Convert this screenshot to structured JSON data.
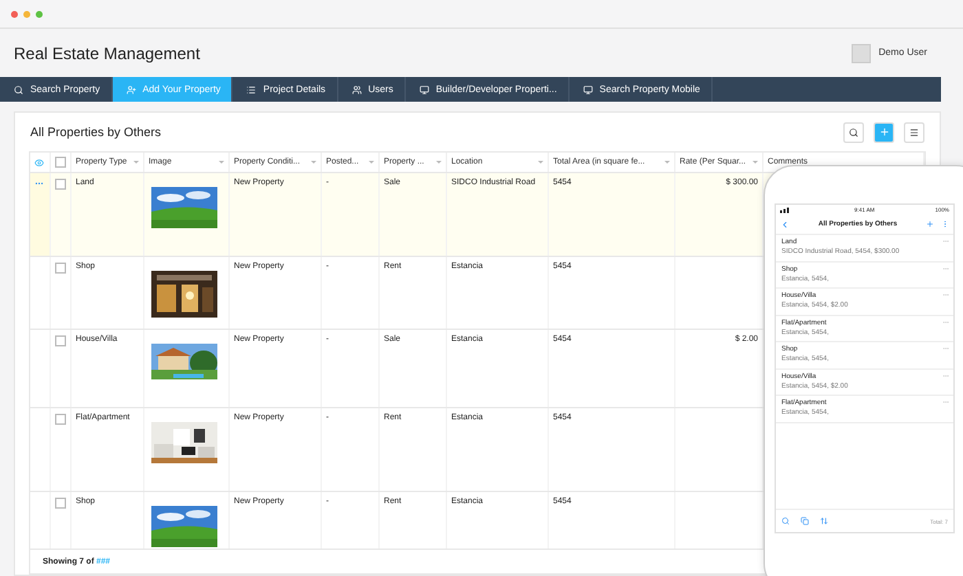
{
  "app": {
    "title": "Real Estate Management",
    "user": "Demo User"
  },
  "nav": [
    {
      "label": "Search Property",
      "selected": false
    },
    {
      "label": "Add Your Property",
      "selected": true
    },
    {
      "label": "Project Details",
      "selected": false
    },
    {
      "label": "Users",
      "selected": false
    },
    {
      "label": "Builder/Developer Properti...",
      "selected": false
    },
    {
      "label": "Search Property Mobile",
      "selected": false
    }
  ],
  "panel": {
    "title": "All Properties by Others",
    "footer_prefix": "Showing 7 of ",
    "footer_link": "###"
  },
  "table": {
    "select_all_checked": false,
    "columns": [
      "Property Type",
      "Image",
      "Property Conditi...",
      "Posted...",
      "Property ...",
      "Location",
      "Total Area (in square fe...",
      "Rate (Per Squar...",
      "Comments"
    ],
    "rows": [
      {
        "selected": true,
        "checked": false,
        "cells": [
          "Land",
          "",
          "New Property",
          "-",
          "Sale",
          "SIDCO Industrial Road",
          "5454",
          "$ 300.00",
          ""
        ]
      },
      {
        "selected": false,
        "checked": false,
        "cells": [
          "Shop",
          "",
          "New Property",
          "-",
          "Rent",
          "Estancia",
          "5454",
          "",
          ""
        ]
      },
      {
        "selected": false,
        "checked": false,
        "cells": [
          "House/Villa",
          "",
          "New Property",
          "-",
          "Sale",
          "Estancia",
          "5454",
          "$ 2.00",
          ""
        ]
      },
      {
        "selected": false,
        "checked": false,
        "cells": [
          "Flat/Apartment",
          "",
          "New Property",
          "-",
          "Rent",
          "Estancia",
          "5454",
          "",
          ""
        ]
      },
      {
        "selected": false,
        "checked": false,
        "cells": [
          "Shop",
          "",
          "New Property",
          "-",
          "Rent",
          "Estancia",
          "5454",
          "",
          ""
        ]
      }
    ]
  },
  "phone": {
    "time": "9:41 AM",
    "battery": "100%",
    "title": "All Properties by Others",
    "total": "Total: 7",
    "items": [
      {
        "title": "Land",
        "subtitle": "SIDCO Industrial Road, 5454, $300.00"
      },
      {
        "title": "Shop",
        "subtitle": "Estancia, 5454,"
      },
      {
        "title": "House/Villa",
        "subtitle": "Estancia, 5454, $2.00"
      },
      {
        "title": "Flat/Apartment",
        "subtitle": "Estancia, 5454,"
      },
      {
        "title": "Shop",
        "subtitle": "Estancia, 5454,"
      },
      {
        "title": "House/Villa",
        "subtitle": "Estancia, 5454, $2.00"
      },
      {
        "title": "Flat/Apartment",
        "subtitle": "Estancia, 5454,"
      }
    ]
  }
}
